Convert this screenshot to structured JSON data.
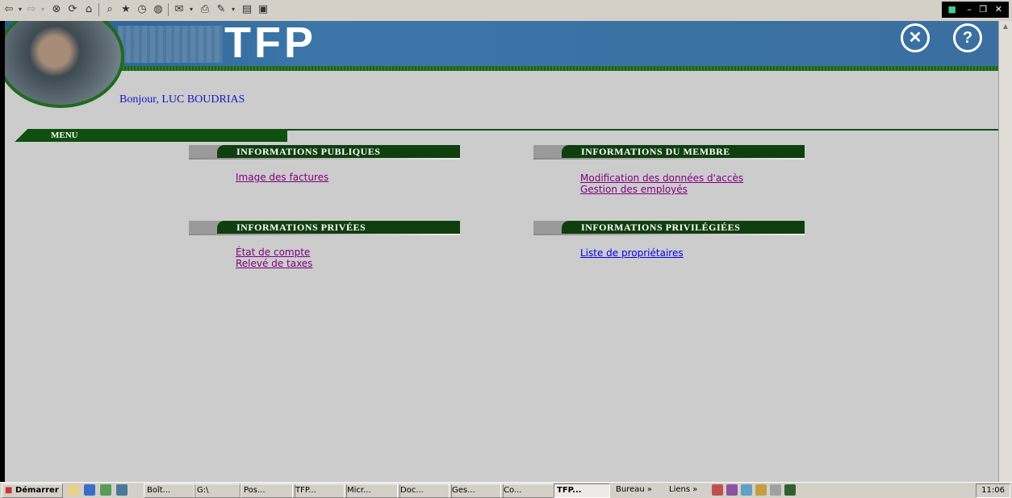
{
  "browser": {
    "toolbar_icons": [
      "back-icon",
      "forward-icon",
      "stop-icon",
      "refresh-icon",
      "home-icon",
      "search-icon",
      "favorites-icon",
      "history-icon",
      "channels-icon",
      "mail-icon",
      "print-icon",
      "edit-icon",
      "discuss-icon",
      "messenger-icon"
    ]
  },
  "header": {
    "brand": "TFP",
    "greeting": "Bonjour, LUC BOUDRIAS"
  },
  "menu": {
    "label": "MENU"
  },
  "sections": {
    "publiques": {
      "title": "INFORMATIONS PUBLIQUES",
      "links": [
        "Image des factures"
      ]
    },
    "membre": {
      "title": "INFORMATIONS DU MEMBRE",
      "links": [
        "Modification des données d'accès",
        "Gestion des employés"
      ]
    },
    "privees": {
      "title": "INFORMATIONS PRIVÉES",
      "links": [
        "État de compte",
        "Relevé de taxes"
      ]
    },
    "privilegiees": {
      "title": "INFORMATIONS PRIVILÉGIÉES",
      "links": [
        "Liste de propriétaires"
      ]
    }
  },
  "taskbar": {
    "start": "Démarrer",
    "tasks": [
      "Boît...",
      "G:\\",
      "Pos...",
      "TFP...",
      "Micr...",
      "Doc...",
      "Ges...",
      "Co...",
      "TFP..."
    ],
    "bureau": "Bureau »",
    "liens": "Liens »",
    "clock": "11:06"
  },
  "colors": {
    "banner": "#3b75a8",
    "green": "#0f3f0f",
    "page_bg": "#cccccc",
    "link_visited": "#800080",
    "link": "#0000ee"
  }
}
